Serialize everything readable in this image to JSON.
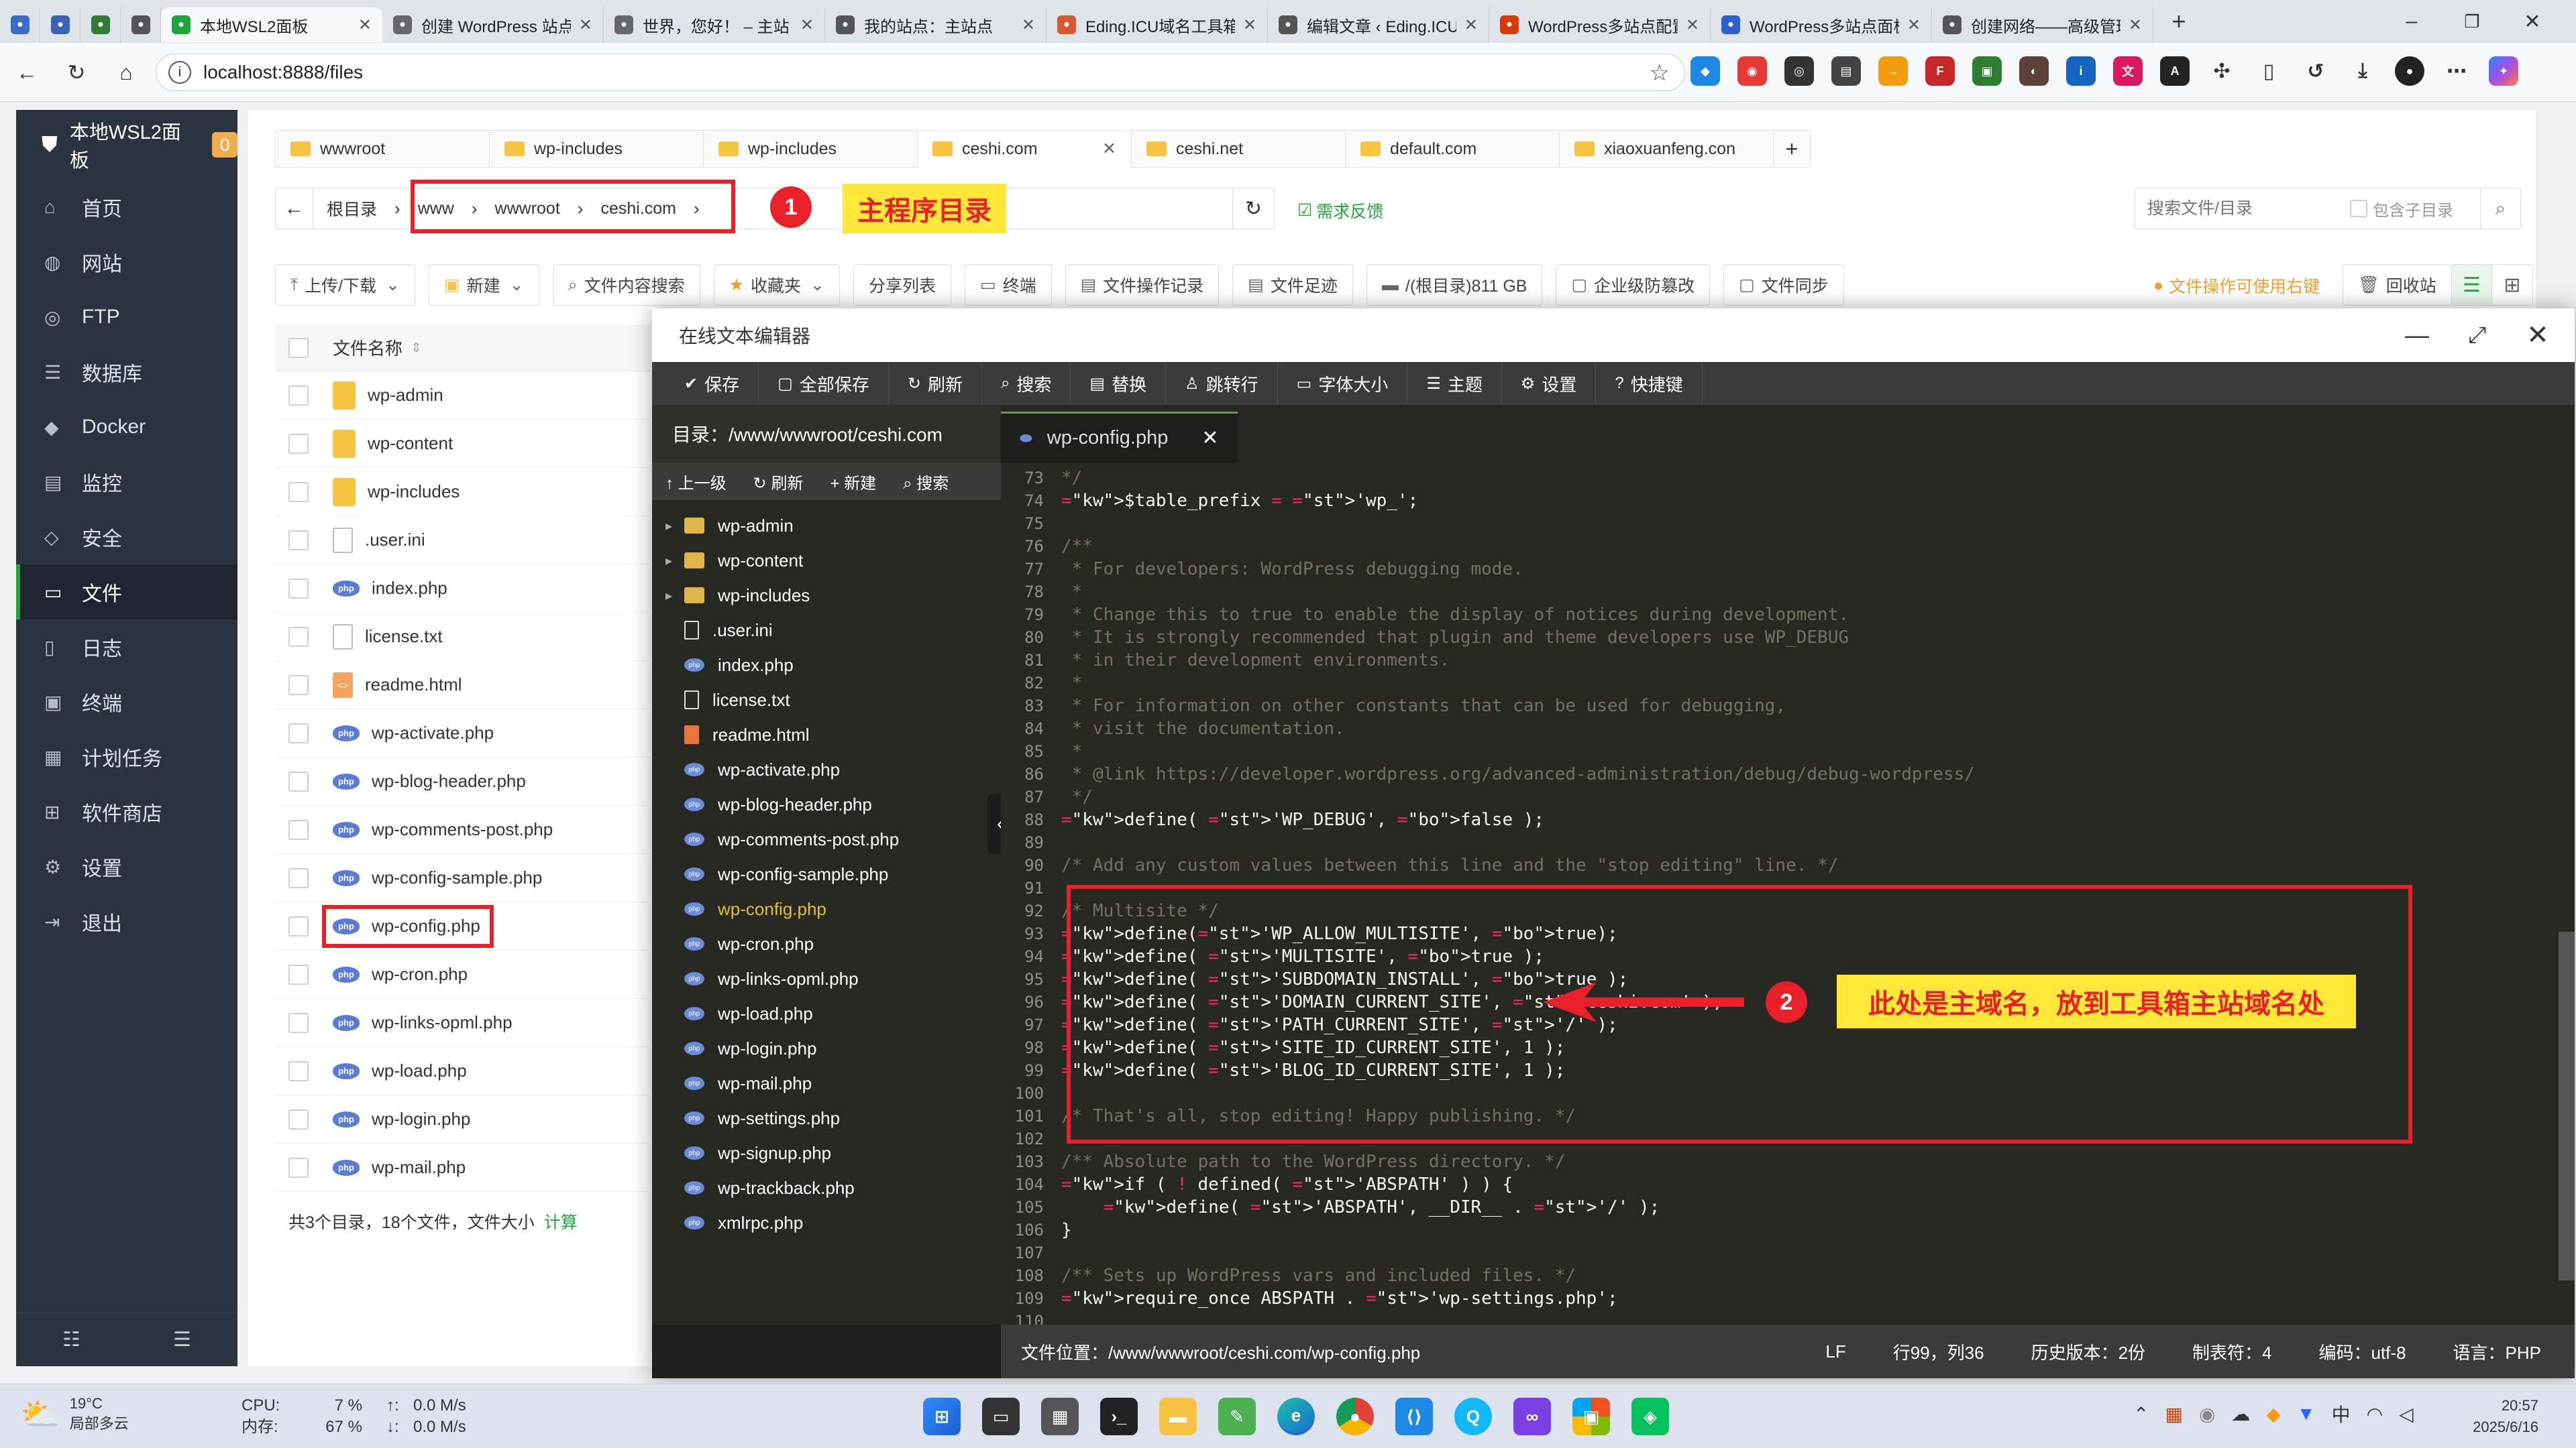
{
  "browser": {
    "tabs": [
      {
        "title": "",
        "icon": "lighthouse-icon",
        "color": "#3b6cc8"
      },
      {
        "title": "",
        "icon": "firefox-icon",
        "color": "#3a63b8"
      },
      {
        "title": "",
        "icon": "leaf-icon",
        "color": "#2e7d32"
      },
      {
        "title": "",
        "icon": "wordpress-icon",
        "color": "#555555"
      },
      {
        "title": "本地WSL2面板",
        "icon": "shield-icon",
        "color": "#20a53a",
        "active": true
      },
      {
        "title": "创建 WordPress 站点",
        "icon": "globe-icon",
        "color": "#666666"
      },
      {
        "title": "世界，您好！ – 主站",
        "icon": "globe-icon",
        "color": "#666666"
      },
      {
        "title": "我的站点：主站点",
        "icon": "wordpress-icon",
        "color": "#555555"
      },
      {
        "title": "Eding.ICU域名工具箱",
        "icon": "chart-icon",
        "color": "#d65a31"
      },
      {
        "title": "编辑文章 ‹ Eding.ICU",
        "icon": "wordpress-icon",
        "color": "#555555"
      },
      {
        "title": "WordPress多站点配置",
        "icon": "windows-icon",
        "color": "#d83b01"
      },
      {
        "title": "WordPress多站点面板",
        "icon": "f-icon",
        "color": "#2b5fce"
      },
      {
        "title": "创建网络——高级管理",
        "icon": "wordpress-icon",
        "color": "#555555"
      }
    ],
    "address": "localhost:8888/files"
  },
  "sidebar": {
    "brand": "本地WSL2面板",
    "badge": "0",
    "items": [
      {
        "label": "首页",
        "icon": "home-icon",
        "glyph": "⌂"
      },
      {
        "label": "网站",
        "icon": "globe-icon",
        "glyph": "◍"
      },
      {
        "label": "FTP",
        "icon": "ftp-icon",
        "glyph": "◎"
      },
      {
        "label": "数据库",
        "icon": "database-icon",
        "glyph": "☰"
      },
      {
        "label": "Docker",
        "icon": "docker-icon",
        "glyph": "◆"
      },
      {
        "label": "监控",
        "icon": "monitor-icon",
        "glyph": "▤"
      },
      {
        "label": "安全",
        "icon": "security-icon",
        "glyph": "◇"
      },
      {
        "label": "文件",
        "icon": "folder-icon",
        "glyph": "▭",
        "active": true
      },
      {
        "label": "日志",
        "icon": "log-icon",
        "glyph": "▯"
      },
      {
        "label": "终端",
        "icon": "terminal-icon",
        "glyph": "▣"
      },
      {
        "label": "计划任务",
        "icon": "schedule-icon",
        "glyph": "▦"
      },
      {
        "label": "软件商店",
        "icon": "apps-icon",
        "glyph": "⊞"
      },
      {
        "label": "设置",
        "icon": "gear-icon",
        "glyph": "⚙"
      },
      {
        "label": "退出",
        "icon": "logout-icon",
        "glyph": "⇥"
      }
    ]
  },
  "files": {
    "tabs": [
      "wwwroot",
      "wp-includes",
      "wp-includes",
      "ceshi.com",
      "ceshi.net",
      "default.com",
      "xiaoxuanfeng.con"
    ],
    "active_tab": 3,
    "breadcrumb": [
      "根目录",
      "www",
      "wwwroot",
      "ceshi.com"
    ],
    "feedback": "需求反馈",
    "search_placeholder": "搜索文件/目录",
    "include_sub": "包含子目录",
    "toolbar": [
      "上传/下载",
      "新建",
      "文件内容搜索",
      "收藏夹",
      "分享列表",
      "终端",
      "文件操作记录",
      "文件足迹",
      "/(根目录)811 GB",
      "企业级防篡改",
      "文件同步"
    ],
    "right_hint": "文件操作可使用右键",
    "recycle": "回收站",
    "col_name": "文件名称",
    "list": [
      {
        "name": "wp-admin",
        "type": "dir"
      },
      {
        "name": "wp-content",
        "type": "dir"
      },
      {
        "name": "wp-includes",
        "type": "dir"
      },
      {
        "name": ".user.ini",
        "type": "txt"
      },
      {
        "name": "index.php",
        "type": "php"
      },
      {
        "name": "license.txt",
        "type": "txt"
      },
      {
        "name": "readme.html",
        "type": "html"
      },
      {
        "name": "wp-activate.php",
        "type": "php"
      },
      {
        "name": "wp-blog-header.php",
        "type": "php"
      },
      {
        "name": "wp-comments-post.php",
        "type": "php"
      },
      {
        "name": "wp-config-sample.php",
        "type": "php"
      },
      {
        "name": "wp-config.php",
        "type": "php"
      },
      {
        "name": "wp-cron.php",
        "type": "php"
      },
      {
        "name": "wp-links-opml.php",
        "type": "php"
      },
      {
        "name": "wp-load.php",
        "type": "php"
      },
      {
        "name": "wp-login.php",
        "type": "php"
      },
      {
        "name": "wp-mail.php",
        "type": "php"
      }
    ],
    "summary": "共3个目录，18个文件，文件大小",
    "summary_link": "计算"
  },
  "editor": {
    "title": "在线文本编辑器",
    "toolbar": [
      {
        "label": "保存",
        "icon": "save-icon",
        "glyph": "✔"
      },
      {
        "label": "全部保存",
        "icon": "save-all-icon",
        "glyph": "▢"
      },
      {
        "label": "刷新",
        "icon": "refresh-icon",
        "glyph": "↻"
      },
      {
        "label": "搜索",
        "icon": "search-icon",
        "glyph": "⌕"
      },
      {
        "label": "替换",
        "icon": "replace-icon",
        "glyph": "▤"
      },
      {
        "label": "跳转行",
        "icon": "jump-icon",
        "glyph": "♙"
      },
      {
        "label": "字体大小",
        "icon": "font-size-icon",
        "glyph": "▭"
      },
      {
        "label": "主题",
        "icon": "theme-icon",
        "glyph": "☰"
      },
      {
        "label": "设置",
        "icon": "gear-icon",
        "glyph": "⚙"
      },
      {
        "label": "快捷键",
        "icon": "help-icon",
        "glyph": "?"
      }
    ],
    "dir_label": "目录：/www/wwwroot/ceshi.com",
    "dir_tools": [
      "上一级",
      "刷新",
      "新建",
      "搜索"
    ],
    "tree": [
      {
        "name": "wp-admin",
        "type": "dir"
      },
      {
        "name": "wp-content",
        "type": "dir"
      },
      {
        "name": "wp-includes",
        "type": "dir"
      },
      {
        "name": ".user.ini",
        "type": "txt"
      },
      {
        "name": "index.php",
        "type": "php"
      },
      {
        "name": "license.txt",
        "type": "txt"
      },
      {
        "name": "readme.html",
        "type": "html"
      },
      {
        "name": "wp-activate.php",
        "type": "php"
      },
      {
        "name": "wp-blog-header.php",
        "type": "php"
      },
      {
        "name": "wp-comments-post.php",
        "type": "php"
      },
      {
        "name": "wp-config-sample.php",
        "type": "php"
      },
      {
        "name": "wp-config.php",
        "type": "php",
        "active": true
      },
      {
        "name": "wp-cron.php",
        "type": "php"
      },
      {
        "name": "wp-links-opml.php",
        "type": "php"
      },
      {
        "name": "wp-load.php",
        "type": "php"
      },
      {
        "name": "wp-login.php",
        "type": "php"
      },
      {
        "name": "wp-mail.php",
        "type": "php"
      },
      {
        "name": "wp-settings.php",
        "type": "php"
      },
      {
        "name": "wp-signup.php",
        "type": "php"
      },
      {
        "name": "wp-trackback.php",
        "type": "php"
      },
      {
        "name": "xmlrpc.php",
        "type": "php"
      }
    ],
    "active_file": "wp-config.php",
    "code": [
      {
        "n": "73",
        "t": "*/",
        "c": "cm"
      },
      {
        "n": "74",
        "t": "$table_prefix = 'wp_';",
        "c": "va"
      },
      {
        "n": "75",
        "t": "",
        "c": "cm"
      },
      {
        "n": "76",
        "t": "/**",
        "c": "cm"
      },
      {
        "n": "77",
        "t": " * For developers: WordPress debugging mode.",
        "c": "cm"
      },
      {
        "n": "78",
        "t": " *",
        "c": "cm"
      },
      {
        "n": "79",
        "t": " * Change this to true to enable the display of notices during development.",
        "c": "cm"
      },
      {
        "n": "80",
        "t": " * It is strongly recommended that plugin and theme developers use WP_DEBUG",
        "c": "cm"
      },
      {
        "n": "81",
        "t": " * in their development environments.",
        "c": "cm"
      },
      {
        "n": "82",
        "t": " *",
        "c": "cm"
      },
      {
        "n": "83",
        "t": " * For information on other constants that can be used for debugging,",
        "c": "cm"
      },
      {
        "n": "84",
        "t": " * visit the documentation.",
        "c": "cm"
      },
      {
        "n": "85",
        "t": " *",
        "c": "cm"
      },
      {
        "n": "86",
        "t": " * @link https://developer.wordpress.org/advanced-administration/debug/debug-wordpress/",
        "c": "cm"
      },
      {
        "n": "87",
        "t": " */",
        "c": "cm"
      },
      {
        "n": "88",
        "t": "define( 'WP_DEBUG', false );",
        "c": "va"
      },
      {
        "n": "89",
        "t": "",
        "c": "cm"
      },
      {
        "n": "90",
        "t": "/* Add any custom values between this line and the \"stop editing\" line. */",
        "c": "cm"
      },
      {
        "n": "91",
        "t": "",
        "c": "cm"
      },
      {
        "n": "92",
        "t": "/* Multisite */",
        "c": "cm"
      },
      {
        "n": "93",
        "t": "define('WP_ALLOW_MULTISITE', true);",
        "c": "va"
      },
      {
        "n": "94",
        "t": "define( 'MULTISITE', true );",
        "c": "va"
      },
      {
        "n": "95",
        "t": "define( 'SUBDOMAIN_INSTALL', true );",
        "c": "va"
      },
      {
        "n": "96",
        "t": "define( 'DOMAIN_CURRENT_SITE', 'ceshi.com' );",
        "c": "va"
      },
      {
        "n": "97",
        "t": "define( 'PATH_CURRENT_SITE', '/' );",
        "c": "va"
      },
      {
        "n": "98",
        "t": "define( 'SITE_ID_CURRENT_SITE', 1 );",
        "c": "va"
      },
      {
        "n": "99",
        "t": "define( 'BLOG_ID_CURRENT_SITE', 1 );",
        "c": "va"
      },
      {
        "n": "100",
        "t": "",
        "c": "cm"
      },
      {
        "n": "101",
        "t": "/* That's all, stop editing! Happy publishing. */",
        "c": "cm"
      },
      {
        "n": "102",
        "t": "",
        "c": "cm"
      },
      {
        "n": "103",
        "t": "/** Absolute path to the WordPress directory. */",
        "c": "cm"
      },
      {
        "n": "104",
        "t": "if ( ! defined( 'ABSPATH' ) ) {",
        "c": "va"
      },
      {
        "n": "105",
        "t": "    define( 'ABSPATH', __DIR__ . '/' );",
        "c": "va"
      },
      {
        "n": "106",
        "t": "}",
        "c": "va"
      },
      {
        "n": "107",
        "t": "",
        "c": "cm"
      },
      {
        "n": "108",
        "t": "/** Sets up WordPress vars and included files. */",
        "c": "cm"
      },
      {
        "n": "109",
        "t": "require_once ABSPATH . 'wp-settings.php';",
        "c": "va"
      },
      {
        "n": "110",
        "t": "",
        "c": "cm"
      }
    ],
    "status": {
      "path": "文件位置：/www/wwwroot/ceshi.com/wp-config.php",
      "eol": "LF",
      "pos": "行99，列36",
      "history": "历史版本：2份",
      "tab": "制表符：4",
      "encoding": "编码：utf-8",
      "lang": "语言：PHP"
    }
  },
  "annotations": {
    "n1": "1",
    "label1": "主程序目录",
    "n2": "2",
    "label2": "此处是主域名，放到工具箱主站域名处"
  },
  "taskbar": {
    "weather_temp": "19°C",
    "weather_desc": "局部多云",
    "cpu_label": "CPU:",
    "cpu": "7 %",
    "mem_label": "内存:",
    "mem": "67 %",
    "up": "0.0 M/s",
    "down": "0.0 M/s",
    "ime": "中",
    "time": "20:57",
    "date": "2025/6/16"
  },
  "colors": {
    "accent": "#20a53a",
    "annotation_red": "#e8202a",
    "annotation_yellow": "#ffe83a"
  }
}
